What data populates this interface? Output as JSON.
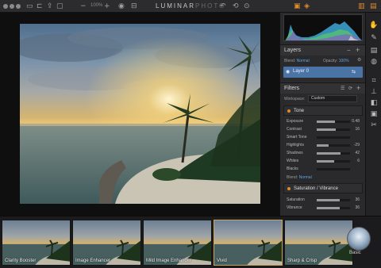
{
  "app": {
    "title_main": "LUMINAR",
    "title_sub": "PHOTO",
    "zoom": "100%"
  },
  "toolbar": {
    "icons": [
      "folder-icon",
      "open-icon",
      "share-icon",
      "export-icon",
      "zoom-out-icon",
      "zoom-in-icon",
      "eye-icon",
      "compare-icon",
      "undo-icon",
      "history-icon",
      "redo-icon"
    ],
    "right_icons": [
      "export-image-icon",
      "layers-toggle-icon",
      "panel-toggle-icon",
      "fullscreen-icon"
    ]
  },
  "layers": {
    "title": "Layers",
    "blend_label": "Blend:",
    "blend_value": "Normal",
    "opacity_label": "Opacity:",
    "opacity_value": "100%",
    "layer_name": "Layer 0"
  },
  "filters": {
    "title": "Filters",
    "workspace_label": "Workspace:",
    "workspace_value": "Custom",
    "tone": {
      "title": "Tone",
      "sliders": [
        {
          "name": "Exposure",
          "value": "0.48",
          "level": 0.55
        },
        {
          "name": "Contrast",
          "value": "16",
          "level": 0.58
        },
        {
          "name": "Smart Tone",
          "value": "",
          "level": 0.0
        },
        {
          "name": "Highlights",
          "value": "-29",
          "level": 0.36
        },
        {
          "name": "Shadows",
          "value": "42",
          "level": 0.71
        },
        {
          "name": "Whites",
          "value": "6",
          "level": 0.53
        },
        {
          "name": "Blacks",
          "value": "",
          "level": 0.0
        }
      ],
      "blend_label": "Blend:",
      "blend_value": "Normal"
    },
    "saturation": {
      "title": "Saturation / Vibrance",
      "sliders": [
        {
          "name": "Saturation",
          "value": "36",
          "level": 0.68
        },
        {
          "name": "Vibrance",
          "value": "36",
          "level": 0.68
        }
      ]
    }
  },
  "presets": [
    {
      "name": "Clarity Booster",
      "selected": false
    },
    {
      "name": "Image Enhancer",
      "selected": false
    },
    {
      "name": "Mild Image Enhancer",
      "selected": false
    },
    {
      "name": "Vivid",
      "selected": true
    },
    {
      "name": "Sharp & Crisp",
      "selected": false
    }
  ],
  "preset_category": "Basic",
  "rail_icons": [
    "adjust-icon",
    "brush-icon",
    "gradient-icon",
    "radial-icon",
    "crop-icon",
    "clone-stamp-icon",
    "eraser-icon",
    "mask-icon",
    "transform-icon"
  ],
  "colors": {
    "accent": "#4a74a6",
    "tone_dot": "#e08a2e",
    "selected_border": "#c8a45a"
  }
}
